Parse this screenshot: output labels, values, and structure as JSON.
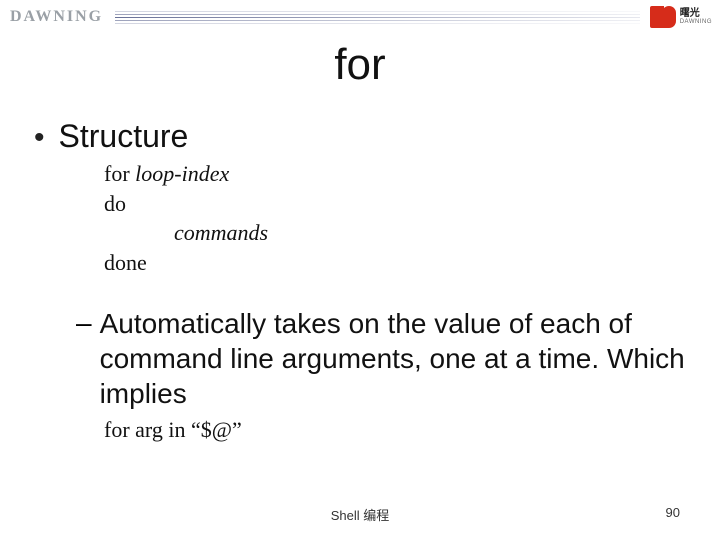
{
  "header": {
    "brand": "DAWNING",
    "logo_cn": "曙光",
    "logo_en": "DAWNING"
  },
  "title": "for",
  "bullet1": {
    "label": "Structure",
    "code": {
      "line1_a": "for ",
      "line1_b": "loop-index",
      "line2": "do",
      "line3": "commands",
      "line4": "done"
    }
  },
  "dash1": {
    "text": "Automatically takes on the value of each of command line arguments, one at a time. Which implies",
    "code": "for arg in “$@”"
  },
  "footer": {
    "label": "Shell 编程",
    "page": "90"
  }
}
